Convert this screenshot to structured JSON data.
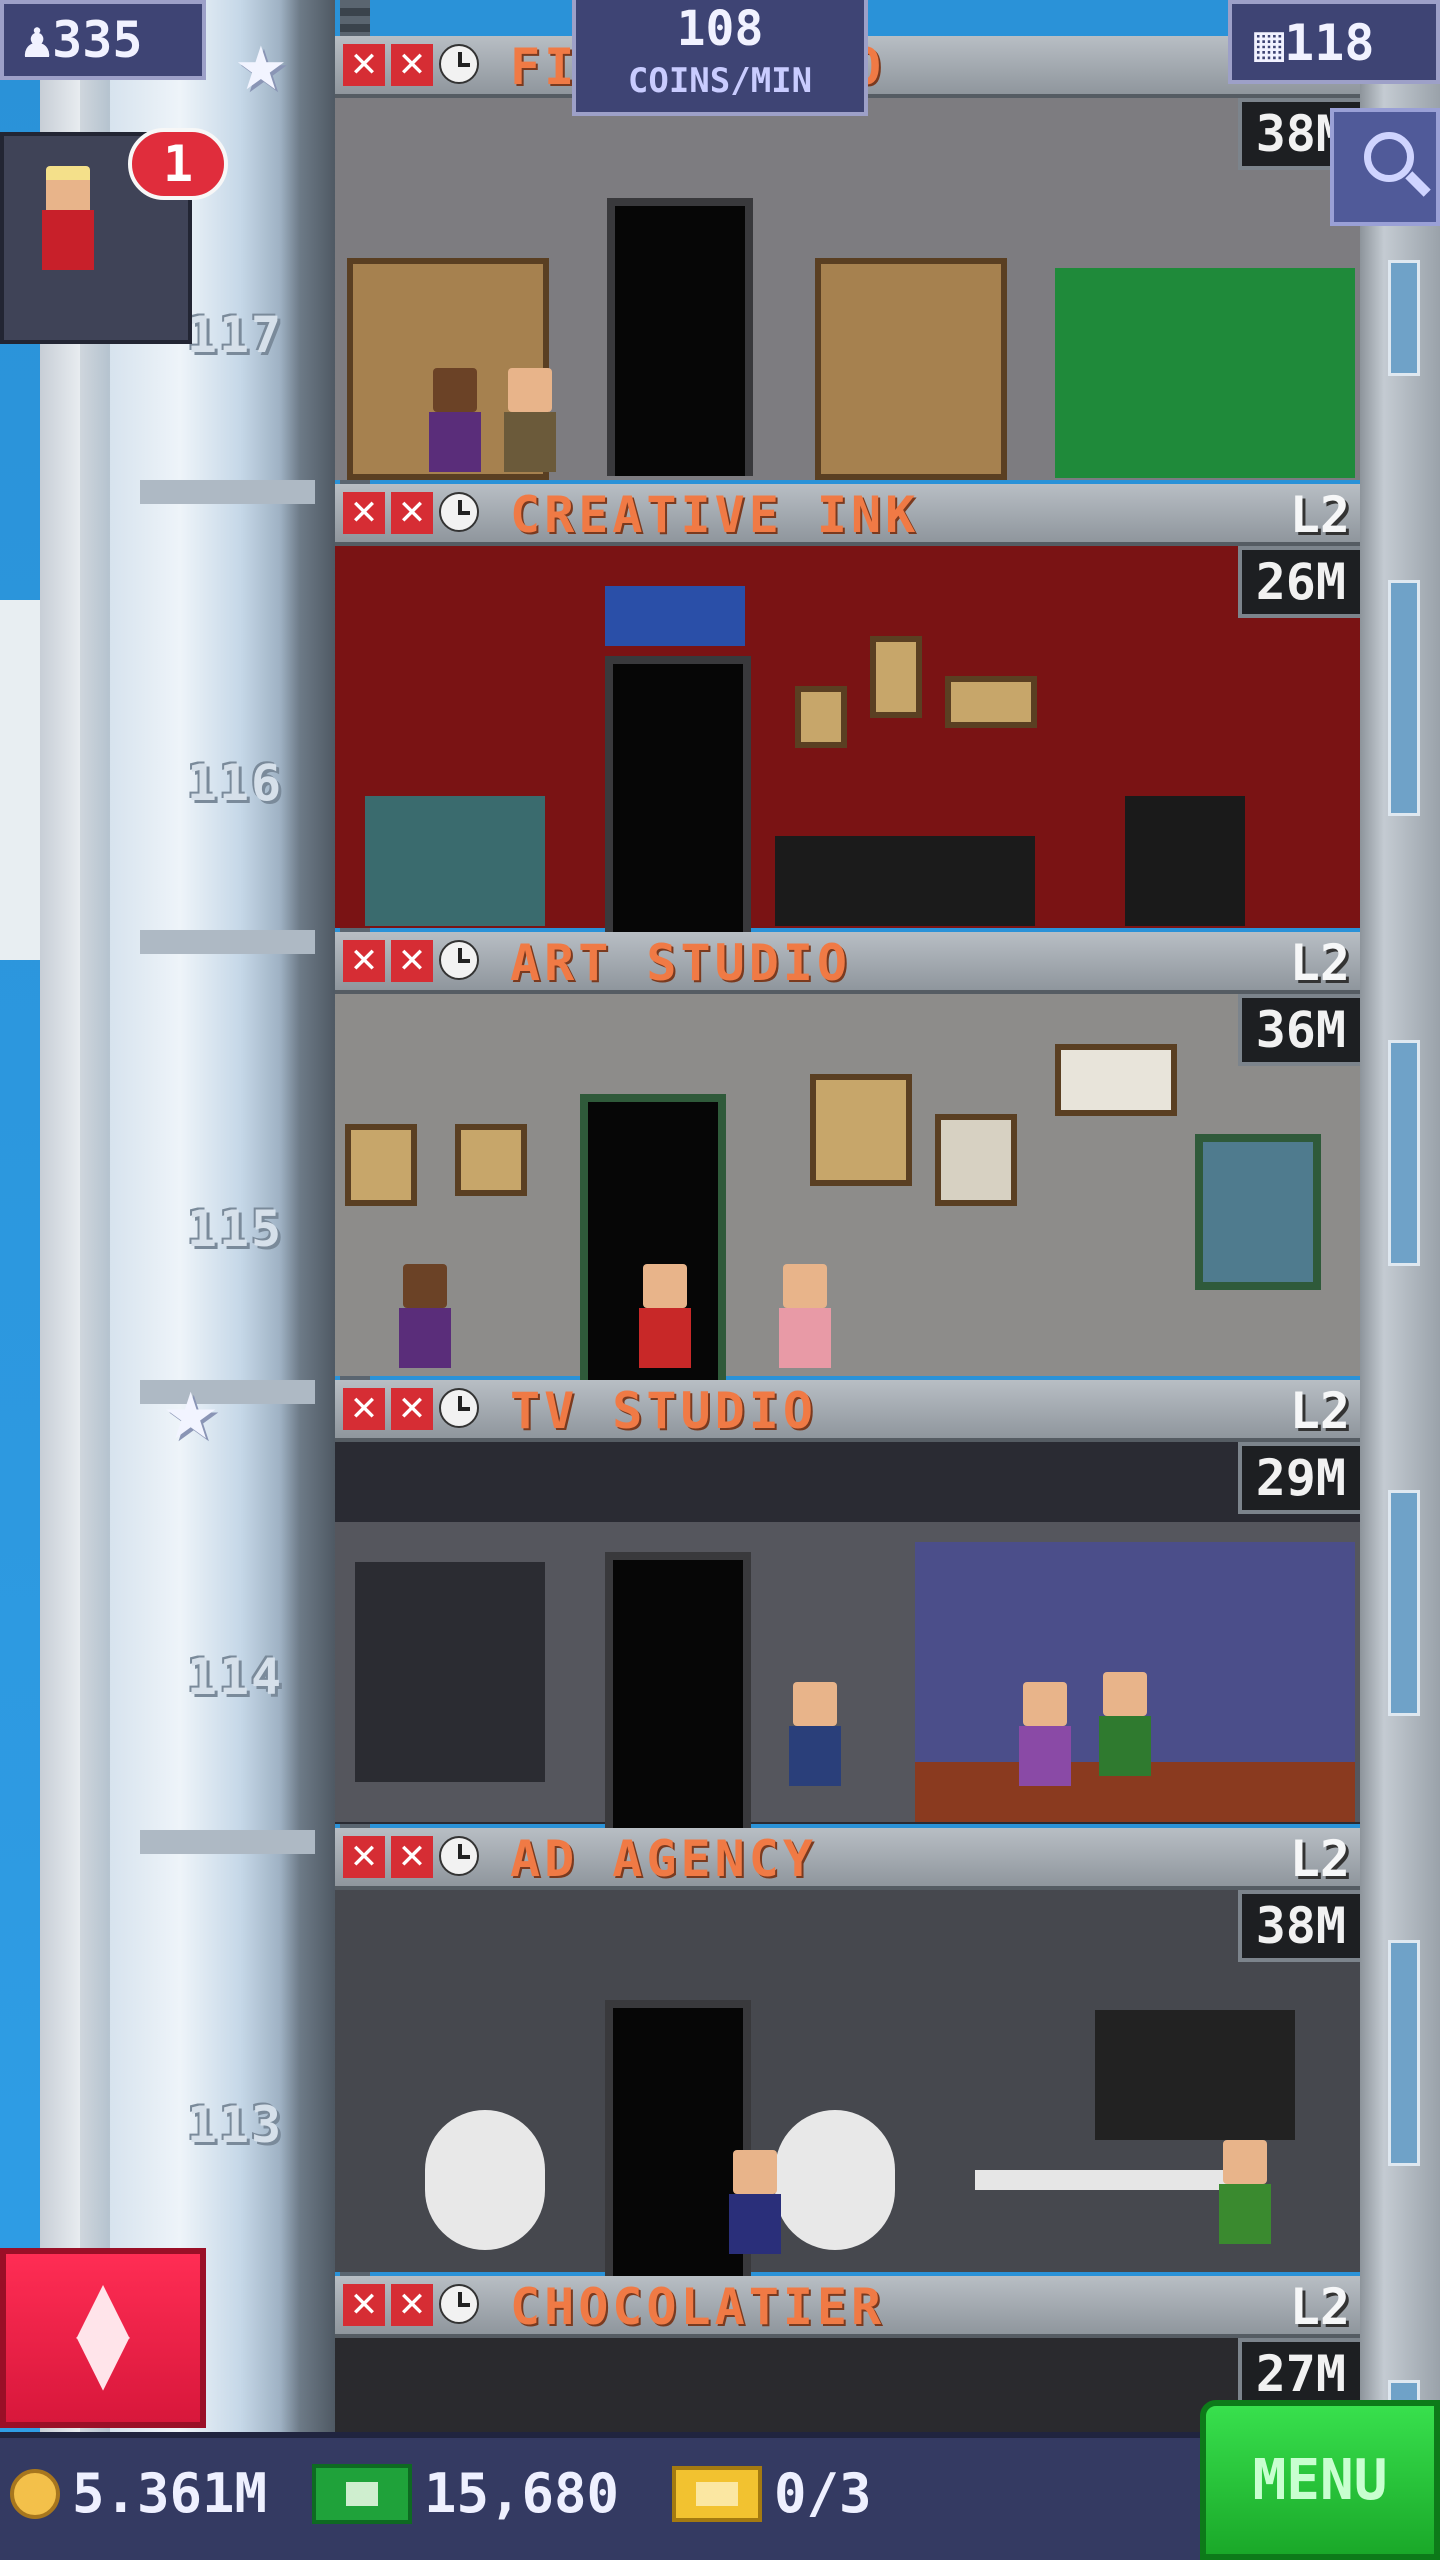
{
  "hud": {
    "population": "335",
    "coins_per_min_value": "108",
    "coins_per_min_label": "COINS/MIN",
    "floors": "118",
    "notification_count": "1"
  },
  "floor_numbers": [
    "117",
    "116",
    "115",
    "114",
    "113"
  ],
  "floors": [
    {
      "name": "FILM STUDIO",
      "level": "",
      "stock": "38M",
      "theme": "film"
    },
    {
      "name": "CREATIVE INK",
      "level": "L2",
      "stock": "26M",
      "theme": "ink"
    },
    {
      "name": "ART STUDIO",
      "level": "L2",
      "stock": "36M",
      "theme": "art"
    },
    {
      "name": "TV STUDIO",
      "level": "L2",
      "stock": "29M",
      "theme": "tv"
    },
    {
      "name": "AD AGENCY",
      "level": "L2",
      "stock": "38M",
      "theme": "ad"
    },
    {
      "name": "CHOCOLATIER",
      "level": "L2",
      "stock": "27M",
      "theme": "choc"
    }
  ],
  "bottom_bar": {
    "coins": "5.361M",
    "bux": "15,680",
    "tickets": "0/3",
    "menu_label": "MENU"
  },
  "icons": {
    "population": "person-icon",
    "floors": "building-icon",
    "search": "magnifier-icon",
    "elevator": "up-down-arrows-icon",
    "coins": "coin-icon",
    "bux": "bux-icon",
    "tickets": "ticket-icon"
  },
  "colors": {
    "floor_name": "#f07a45",
    "menu_green": "#1aa829",
    "elevator_red": "#e02040",
    "hud_blue": "#3e4474"
  }
}
